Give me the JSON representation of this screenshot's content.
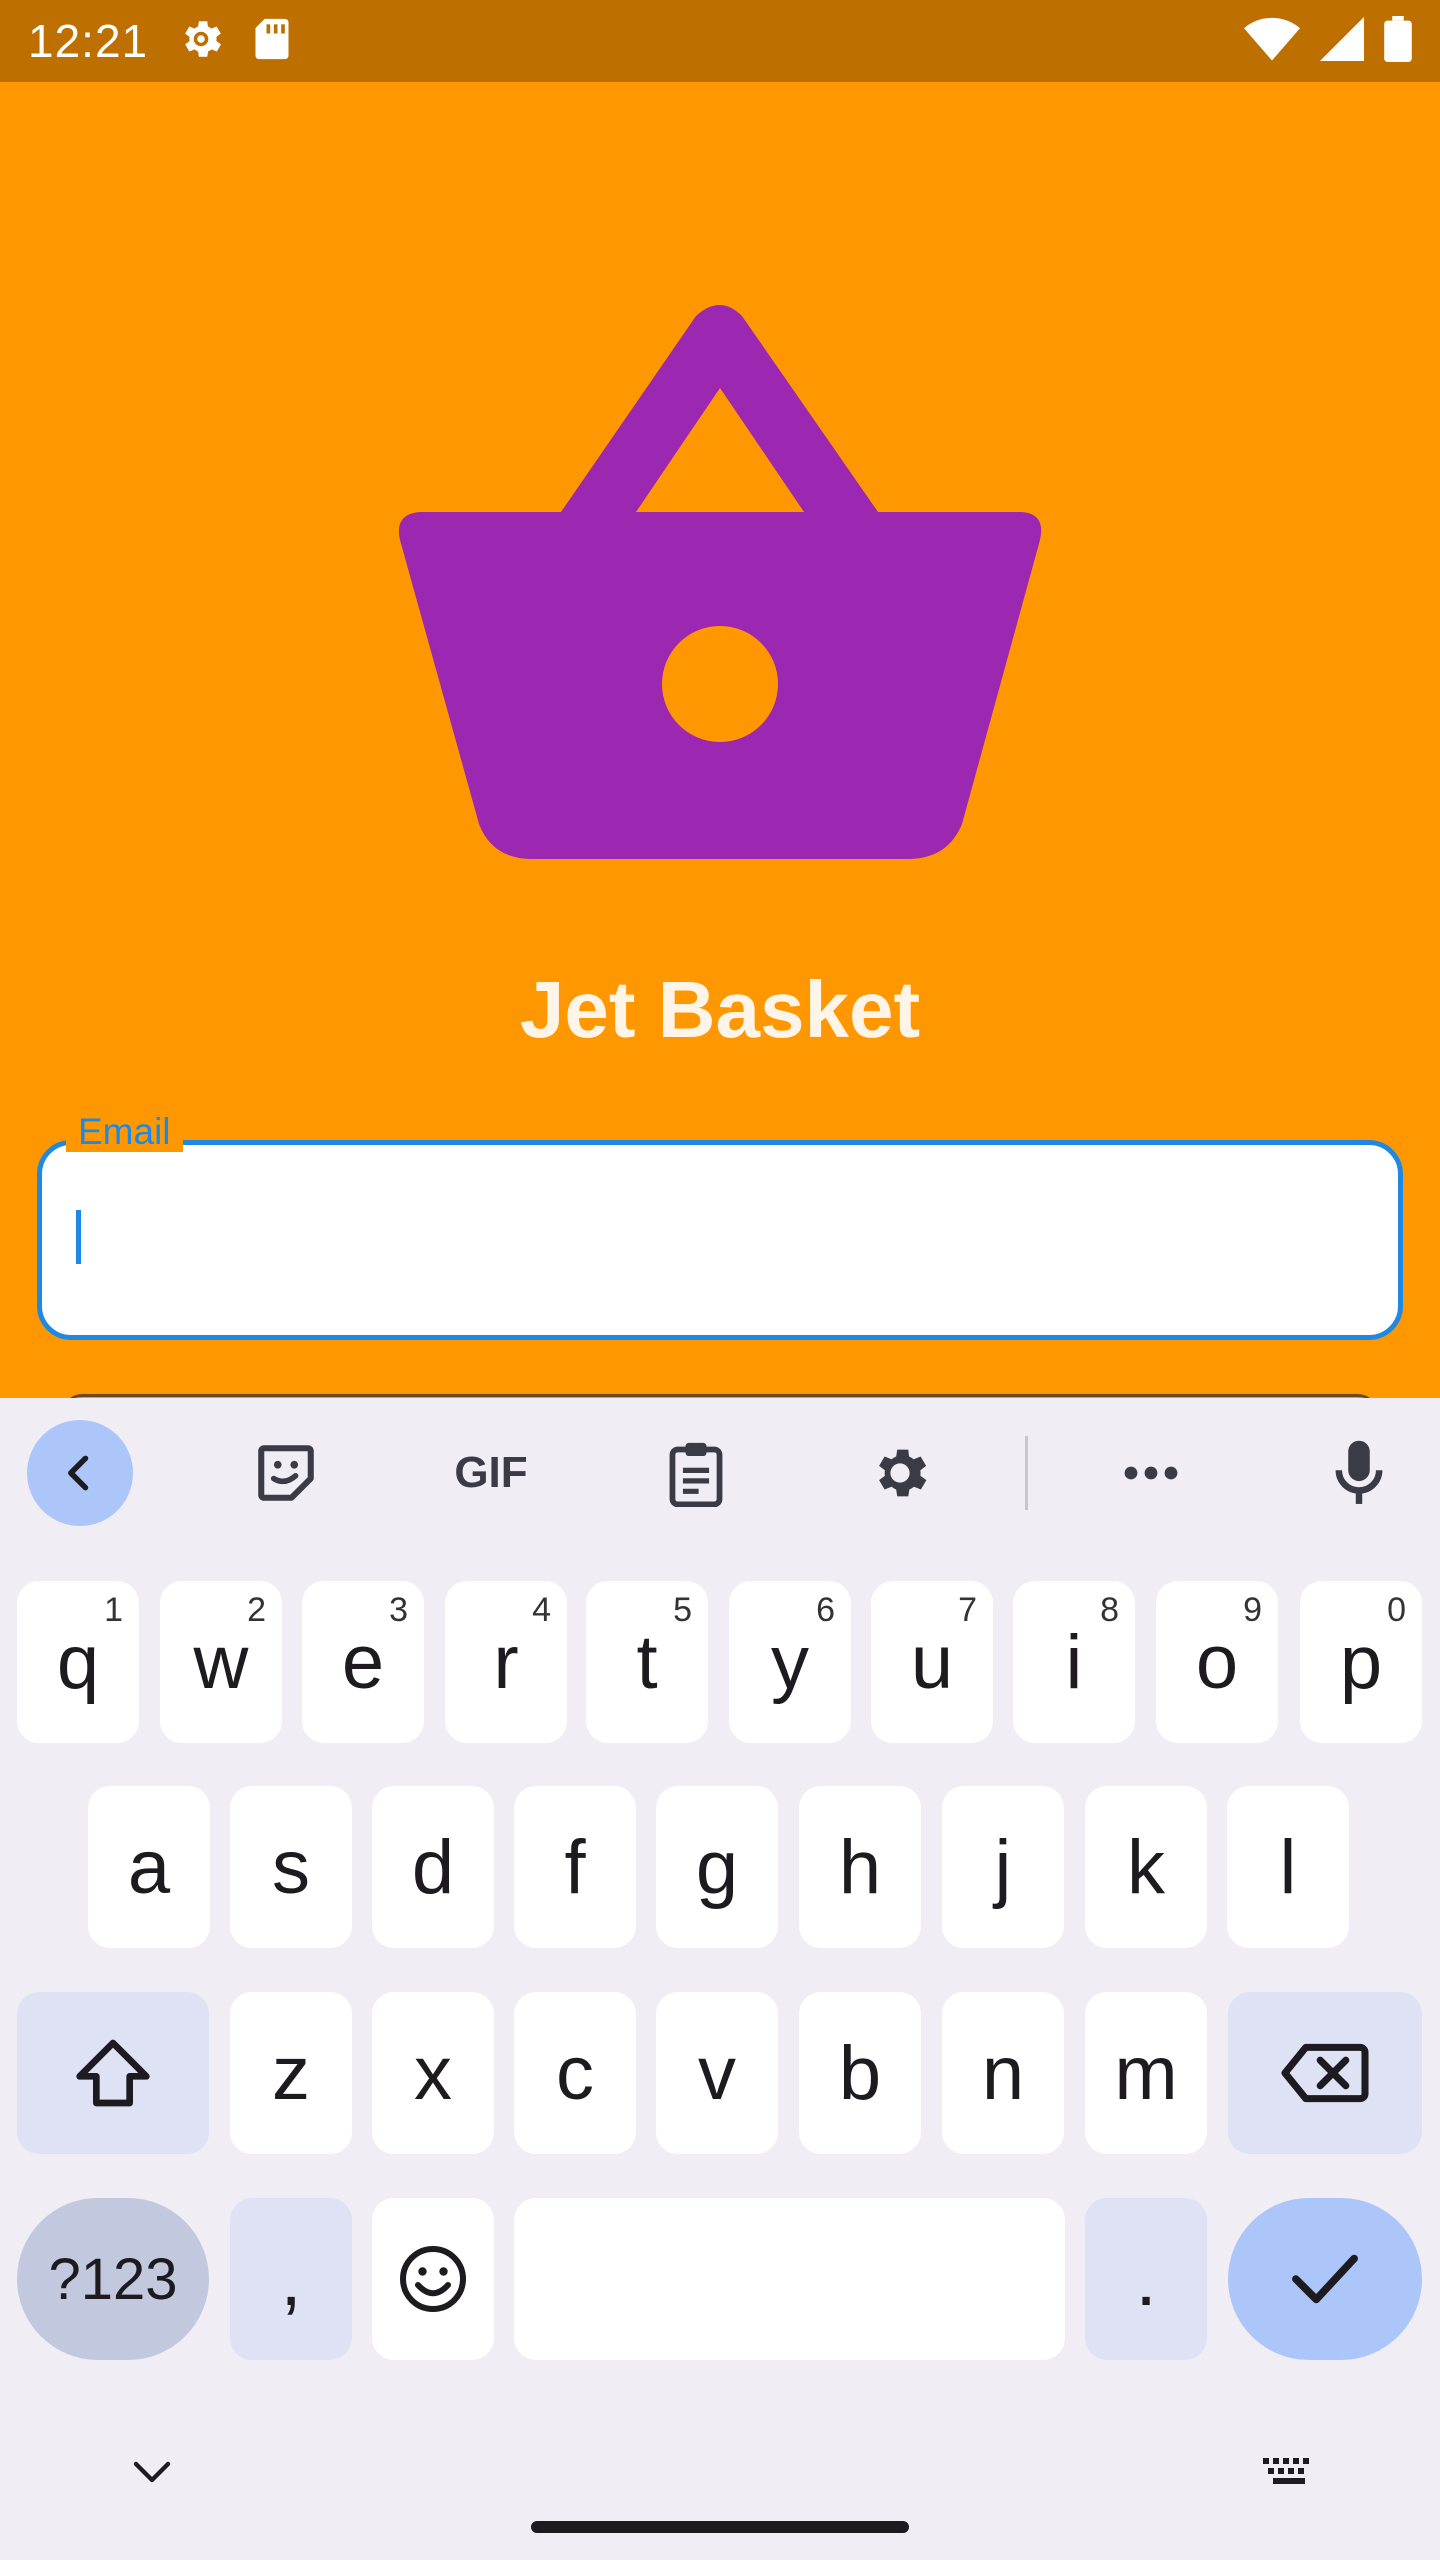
{
  "status_bar": {
    "time": "12:21",
    "left_icons": [
      "settings-gear-icon",
      "sd-card-icon"
    ],
    "right_icons": [
      "wifi-icon",
      "cell-signal-icon",
      "battery-icon"
    ],
    "background": "#bd7000"
  },
  "app": {
    "background": "#ff9800",
    "logo_icon": "shopping-basket-icon",
    "logo_color": "#9c27b0",
    "title": "Jet Basket",
    "email_field": {
      "label": "Email",
      "value": "",
      "accent": "#1e88e5"
    }
  },
  "keyboard": {
    "toolbar": [
      "back-icon",
      "sticker-icon",
      "gif-icon",
      "clipboard-icon",
      "settings-icon",
      "more-icon",
      "mic-icon"
    ],
    "gif_label": "GIF",
    "row1": [
      {
        "key": "q",
        "hint": "1"
      },
      {
        "key": "w",
        "hint": "2"
      },
      {
        "key": "e",
        "hint": "3"
      },
      {
        "key": "r",
        "hint": "4"
      },
      {
        "key": "t",
        "hint": "5"
      },
      {
        "key": "y",
        "hint": "6"
      },
      {
        "key": "u",
        "hint": "7"
      },
      {
        "key": "i",
        "hint": "8"
      },
      {
        "key": "o",
        "hint": "9"
      },
      {
        "key": "p",
        "hint": "0"
      }
    ],
    "row2": [
      "a",
      "s",
      "d",
      "f",
      "g",
      "h",
      "j",
      "k",
      "l"
    ],
    "row3": [
      "z",
      "x",
      "c",
      "v",
      "b",
      "n",
      "m"
    ],
    "bottom": {
      "symbols": "?123",
      "comma": ",",
      "period": "."
    }
  }
}
